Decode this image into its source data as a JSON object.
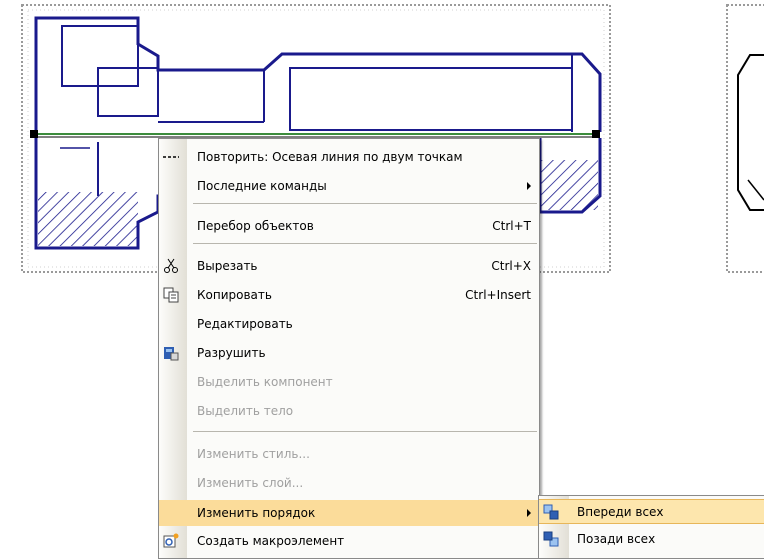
{
  "context_menu": {
    "items": [
      {
        "label": "Повторить: Осевая линия по двум точкам",
        "shortcut": "",
        "icon": "dashed-line-icon",
        "disabled": false
      },
      {
        "label": "Последние команды",
        "shortcut": "",
        "icon": "",
        "disabled": false,
        "submenu": true
      },
      {
        "label": "Перебор объектов",
        "shortcut": "Ctrl+T",
        "icon": "",
        "disabled": false
      },
      {
        "label": "Вырезать",
        "shortcut": "Ctrl+X",
        "icon": "scissors-icon",
        "disabled": false
      },
      {
        "label": "Копировать",
        "shortcut": "Ctrl+Insert",
        "icon": "copy-icon",
        "disabled": false
      },
      {
        "label": "Редактировать",
        "shortcut": "",
        "icon": "",
        "disabled": false
      },
      {
        "label": "Разрушить",
        "shortcut": "",
        "icon": "destroy-icon",
        "disabled": false
      },
      {
        "label": "Выделить компонент",
        "shortcut": "",
        "icon": "",
        "disabled": true
      },
      {
        "label": "Выделить тело",
        "shortcut": "",
        "icon": "",
        "disabled": true
      },
      {
        "label": "Изменить стиль...",
        "shortcut": "",
        "icon": "",
        "disabled": true
      },
      {
        "label": "Изменить слой...",
        "shortcut": "",
        "icon": "",
        "disabled": true
      },
      {
        "label": "Изменить порядок",
        "shortcut": "",
        "icon": "",
        "disabled": false,
        "submenu": true,
        "highlighted": true
      },
      {
        "label": "Создать макроэлемент",
        "shortcut": "",
        "icon": "macro-element-icon",
        "disabled": false
      }
    ]
  },
  "order_submenu": {
    "items": [
      {
        "label": "Впереди всех",
        "icon": "bring-to-front-icon",
        "highlighted": true
      },
      {
        "label": "Позади всех",
        "icon": "send-to-back-icon",
        "highlighted": false
      }
    ]
  },
  "colors": {
    "drawing_line": "#1a1a8c",
    "highlight": "#fbdc9a",
    "selection_axis": "#3c8c3c"
  }
}
